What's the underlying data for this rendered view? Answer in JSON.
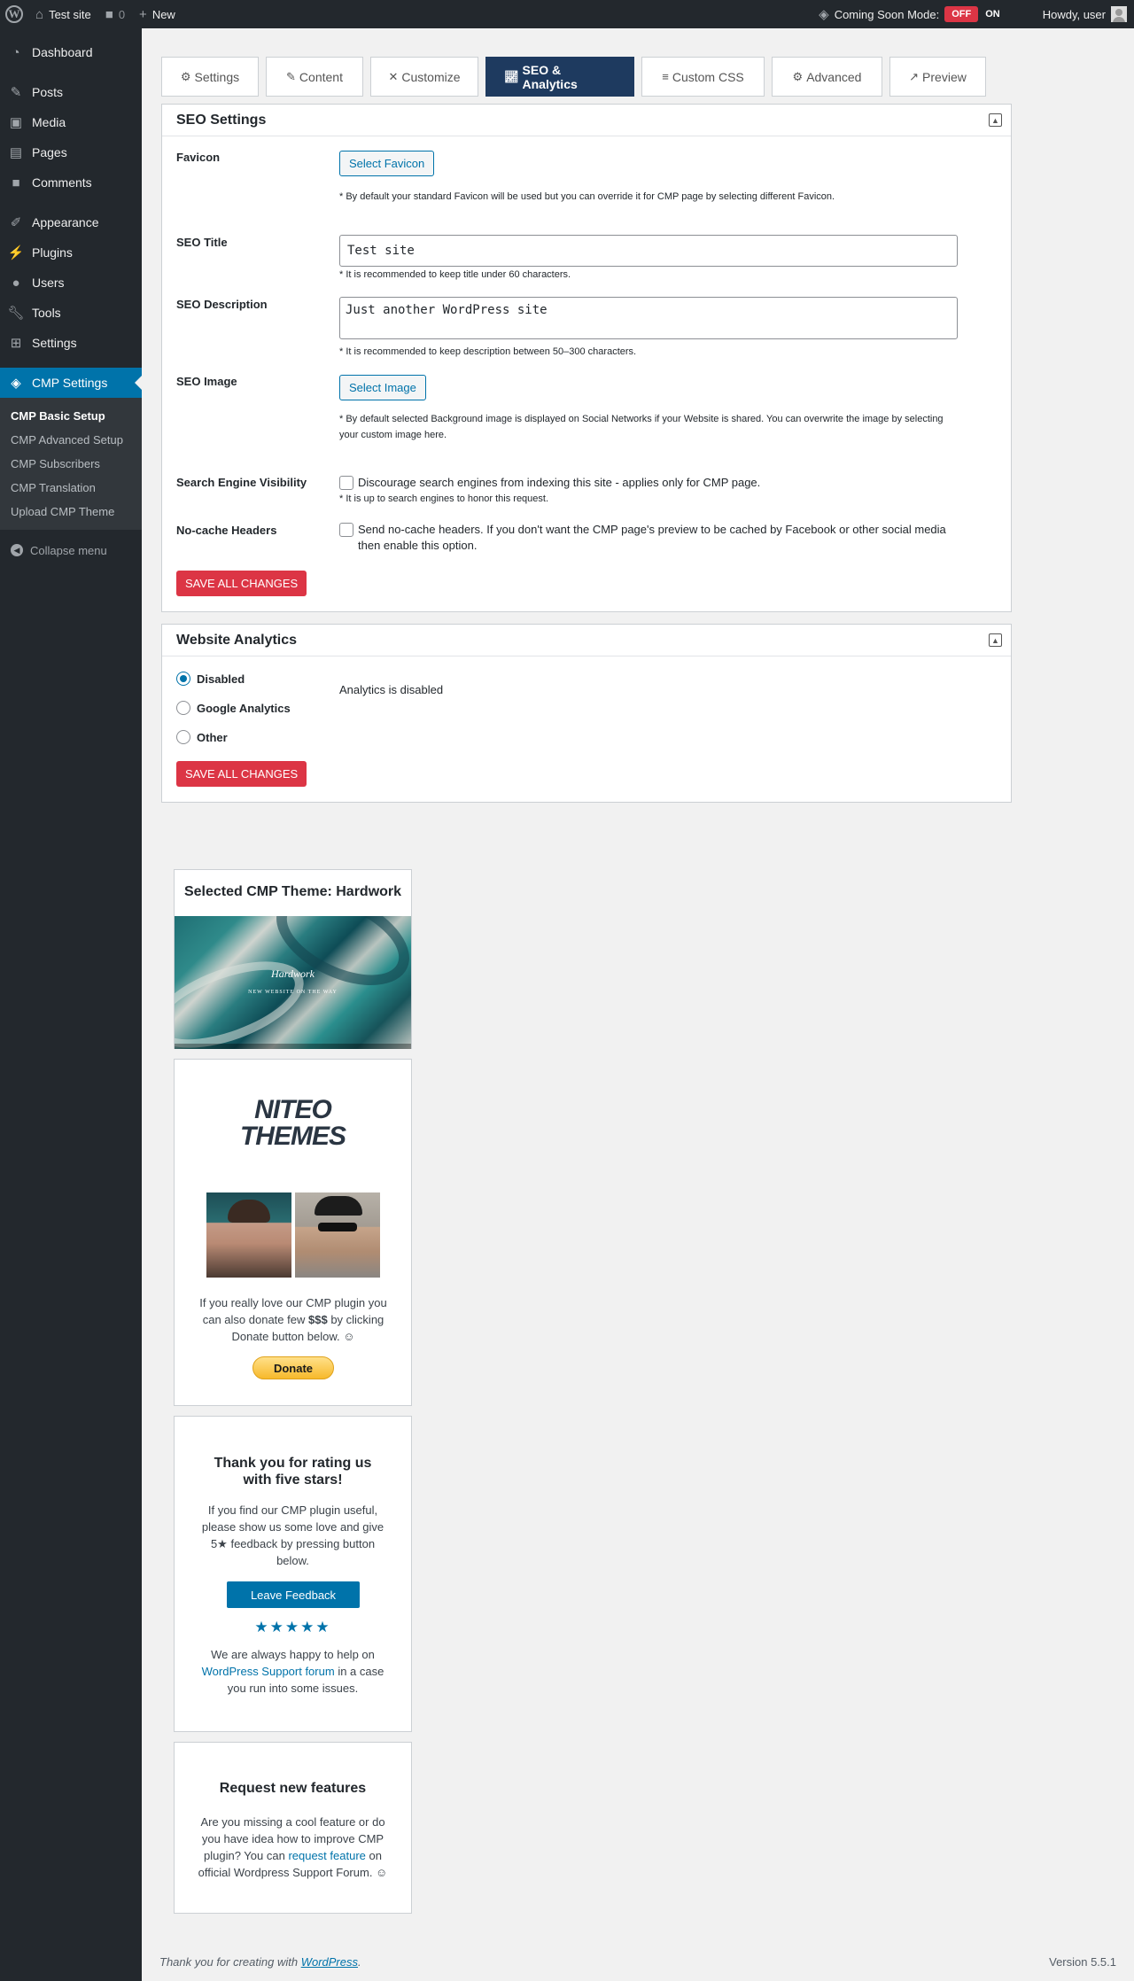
{
  "adminbar": {
    "site_name": "Test site",
    "comments_count": "0",
    "new_label": "New",
    "coming_soon_label": "Coming Soon Mode:",
    "toggle_off": "OFF",
    "toggle_on": "ON",
    "howdy": "Howdy, user"
  },
  "sidebar": {
    "items": [
      {
        "label": "Dashboard",
        "icon": "dashboard-icon"
      },
      {
        "label": "Posts",
        "icon": "pin-icon"
      },
      {
        "label": "Media",
        "icon": "media-icon"
      },
      {
        "label": "Pages",
        "icon": "page-icon"
      },
      {
        "label": "Comments",
        "icon": "comment-icon"
      },
      {
        "label": "Appearance",
        "icon": "brush-icon"
      },
      {
        "label": "Plugins",
        "icon": "plugin-icon"
      },
      {
        "label": "Users",
        "icon": "users-icon"
      },
      {
        "label": "Tools",
        "icon": "wrench-icon"
      },
      {
        "label": "Settings",
        "icon": "settings-icon"
      },
      {
        "label": "CMP Settings",
        "icon": "cmp-icon"
      }
    ],
    "submenu": [
      "CMP Basic Setup",
      "CMP Advanced Setup",
      "CMP Subscribers",
      "CMP Translation",
      "Upload CMP Theme"
    ],
    "collapse": "Collapse menu"
  },
  "tabs": [
    {
      "label": "Settings",
      "icon": "gear-icon"
    },
    {
      "label": "Content",
      "icon": "edit-icon"
    },
    {
      "label": "Customize",
      "icon": "tools-icon"
    },
    {
      "label": "SEO & Analytics",
      "icon": "chart-icon"
    },
    {
      "label": "Custom CSS",
      "icon": "css-icon"
    },
    {
      "label": "Advanced",
      "icon": "gears-icon"
    },
    {
      "label": "Preview",
      "icon": "external-link-icon"
    }
  ],
  "seo": {
    "title": "SEO Settings",
    "favicon_label": "Favicon",
    "favicon_button": "Select Favicon",
    "favicon_note": "* By default your standard Favicon will be used but you can override it for CMP page by selecting different Favicon.",
    "seo_title_label": "SEO Title",
    "seo_title_value": "Test site",
    "seo_title_note": "* It is recommended to keep title under 60 characters.",
    "seo_desc_label": "SEO Description",
    "seo_desc_value": "Just another WordPress site",
    "seo_desc_note": "* It is recommended to keep description between 50–300 characters.",
    "seo_image_label": "SEO Image",
    "seo_image_button": "Select Image",
    "seo_image_note": "* By default selected Background image is displayed on Social Networks if your Website is shared. You can overwrite the image by selecting your custom image here.",
    "visibility_label": "Search Engine Visibility",
    "visibility_text": "Discourage search engines from indexing this site - applies only for CMP page.",
    "visibility_note": "* It is up to search engines to honor this request.",
    "nocache_label": "No-cache Headers",
    "nocache_text": "Send no-cache headers. If you don't want the CMP page's preview to be cached by Facebook or other social media then enable this option.",
    "save": "SAVE ALL CHANGES"
  },
  "analytics": {
    "title": "Website Analytics",
    "options": [
      "Disabled",
      "Google Analytics",
      "Other"
    ],
    "selected": "Disabled",
    "status": "Analytics is disabled",
    "save": "SAVE ALL CHANGES"
  },
  "widgets": {
    "theme_title": "Selected CMP Theme: Hardwork",
    "theme_script": "Hardwork",
    "theme_tagline": "NEW WEBSITE ON THE WAY",
    "logo_line1": "NITEO",
    "logo_line2": "THEMES",
    "donate_text_1": "If you really love our CMP plugin you can also donate few",
    "donate_money": "$$$",
    "donate_text_2": "by clicking Donate button below. ☺",
    "donate_button": "Donate",
    "rating_title": "Thank you for rating us with five stars!",
    "rating_text_1": "If you find our CMP plugin useful, please show us some love and give 5",
    "rating_text_2": "feedback by pressing button below.",
    "feedback_button": "Leave Feedback",
    "stars": "★★★★★",
    "help_text_1": "We are always happy to help on",
    "help_link": "WordPress Support forum",
    "help_text_2": "in a case you run into some issues.",
    "features_title": "Request new features",
    "features_text_1": "Are you missing a cool feature or do you have idea how to improve CMP plugin? You can",
    "features_link": "request feature",
    "features_text_2": "on official Wordpress Support Forum. ☺"
  },
  "footer": {
    "thanks": "Thank you for creating with",
    "wp_link": "WordPress",
    "period": ".",
    "version": "Version 5.5.1"
  },
  "colors": {
    "accent": "#0073aa",
    "active_tab": "#1e3a5f",
    "save_button": "#dc3545"
  }
}
